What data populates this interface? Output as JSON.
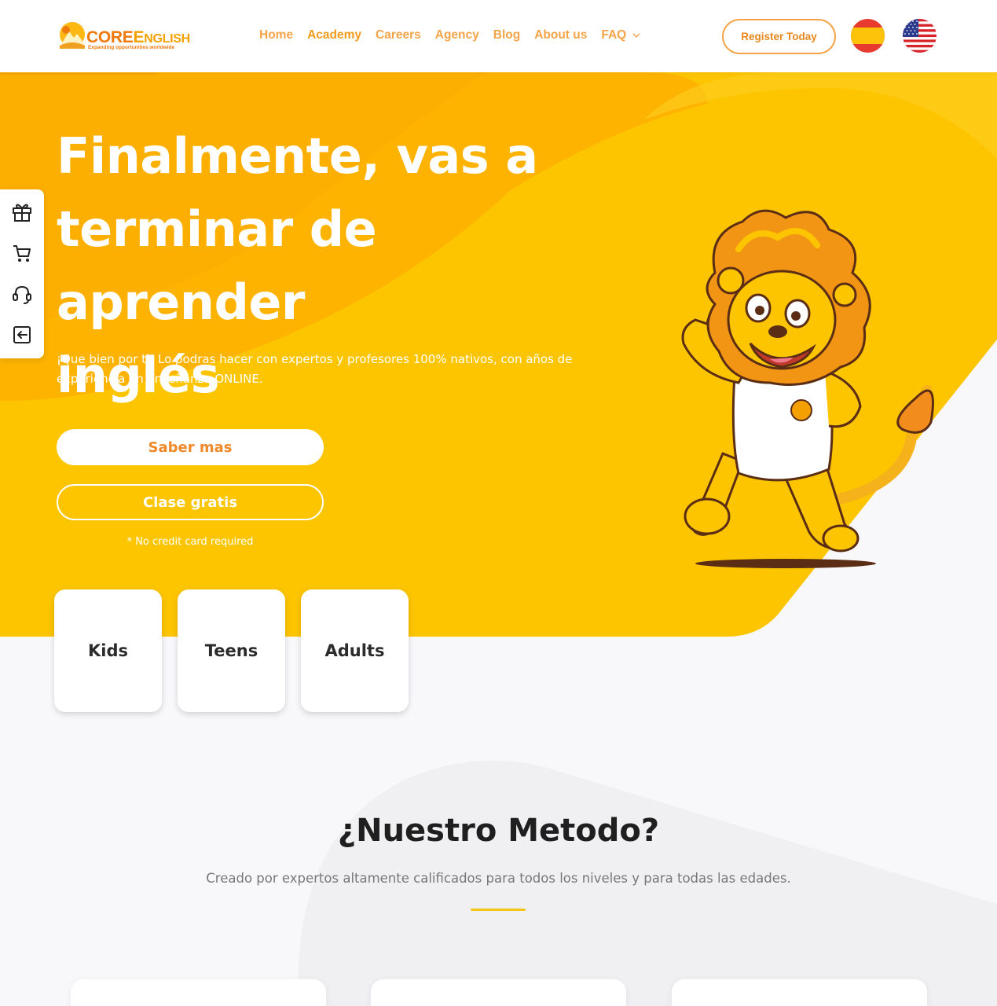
{
  "brand": {
    "name_core": "CORE",
    "name_rest_big": "E",
    "name_rest_small": "NGLISH",
    "tagline": "Expanding opportunities worldwide",
    "primary_color": "#fdc500",
    "accent_color": "#f0892a"
  },
  "nav": {
    "items": [
      {
        "label": "Home"
      },
      {
        "label": "Academy"
      },
      {
        "label": "Careers"
      },
      {
        "label": "Agency"
      },
      {
        "label": "Blog"
      },
      {
        "label": "About us"
      },
      {
        "label": "FAQ"
      }
    ],
    "register_label": "Register Today",
    "languages": [
      "spain-flag-icon",
      "usa-flag-icon"
    ]
  },
  "side_toolbar": {
    "icons": [
      "gift-icon",
      "cart-icon",
      "headset-icon",
      "exit-icon"
    ]
  },
  "hero": {
    "title_line1": "Finalmente, vas a",
    "title_line2": "terminar de aprender",
    "title_line3": "inglés",
    "subtitle": "¡Que bien por ti! Lo podras hacer con expertos y profesores 100% nativos, con años de experiencia en enseñanza ONLINE.",
    "primary_cta": "Saber mas",
    "secondary_cta": "Clase gratis",
    "note": "* No credit card required"
  },
  "audience": {
    "cards": [
      {
        "label": "Kids"
      },
      {
        "label": "Teens"
      },
      {
        "label": "Adults"
      }
    ]
  },
  "metodo": {
    "title": "¿Nuestro Metodo?",
    "subtitle": "Creado por expertos altamente calificados para todos los niveles y para todas las edades."
  }
}
